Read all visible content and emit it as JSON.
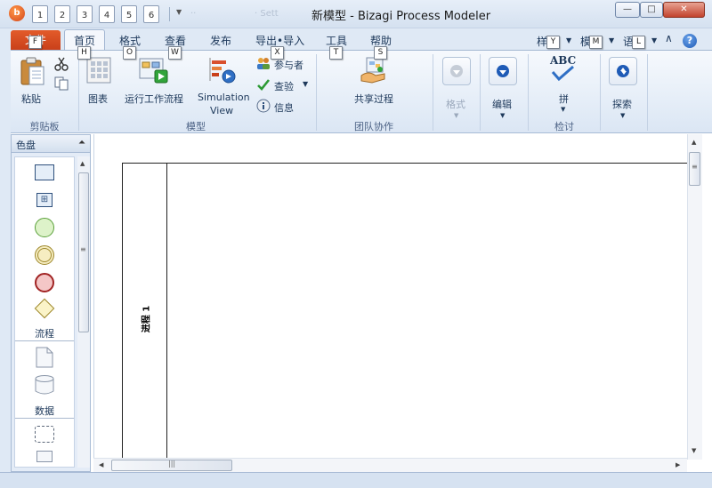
{
  "window": {
    "app_icon": "bizagi-logo-icon",
    "app_glyph": "b",
    "title": "新模型 - Bizagi Process Modeler",
    "quick_access_keytips": [
      "1",
      "2",
      "3",
      "4",
      "5",
      "6"
    ],
    "ghost_labels": [
      "··",
      "· Sett"
    ],
    "minimize_label": "—",
    "maximize_label": "□",
    "close_label": "✕"
  },
  "tabs": {
    "file": {
      "label": "文件",
      "keytip": "F"
    },
    "items": [
      {
        "label": "首页",
        "keytip": "H",
        "active": true
      },
      {
        "label": "格式",
        "keytip": "O"
      },
      {
        "label": "查看",
        "keytip": "W"
      },
      {
        "label": "发布",
        "keytip": "X"
      },
      {
        "label": "导出•导入",
        "keytip": "T"
      },
      {
        "label": "工具",
        "keytip": "S"
      },
      {
        "label": "帮助",
        "keytip": ""
      }
    ],
    "right": [
      {
        "label": "样",
        "keytip": "Y"
      },
      {
        "label": "模",
        "keytip": "M"
      },
      {
        "label": "语",
        "keytip": "L"
      }
    ],
    "collapse_glyph": "∧",
    "help_glyph": "?"
  },
  "ribbon": {
    "clipboard": {
      "group_label": "剪贴板",
      "paste_label": "粘贴",
      "cut_icon": "scissors-icon",
      "copy_icon": "copy-icon"
    },
    "model": {
      "group_label": "模型",
      "diagram_label": "图表",
      "run_label": "运行工作流程",
      "simulation_line1": "Simulation",
      "simulation_line2": "View",
      "participants_label": "参与者",
      "check_label": "查验",
      "info_label": "信息"
    },
    "collaboration": {
      "group_label": "团队协作",
      "share_label": "共享过程"
    },
    "format": {
      "label": "格式",
      "enabled": false
    },
    "edit": {
      "label": "编辑"
    },
    "review": {
      "group_label": "检讨",
      "spell_label": "拼",
      "abc_text": "ABC"
    },
    "explore": {
      "label": "探索"
    }
  },
  "palette": {
    "title": "色盘",
    "pin_icon": "pin-icon",
    "sections": [
      {
        "title": "流程"
      },
      {
        "title": "数据"
      }
    ]
  },
  "canvas": {
    "pool_name": "进程 1"
  },
  "colors": {
    "file_tab": "#d24a1e",
    "ribbon_bg": "#e3ecf7",
    "accent_blue": "#1f5bb6"
  }
}
